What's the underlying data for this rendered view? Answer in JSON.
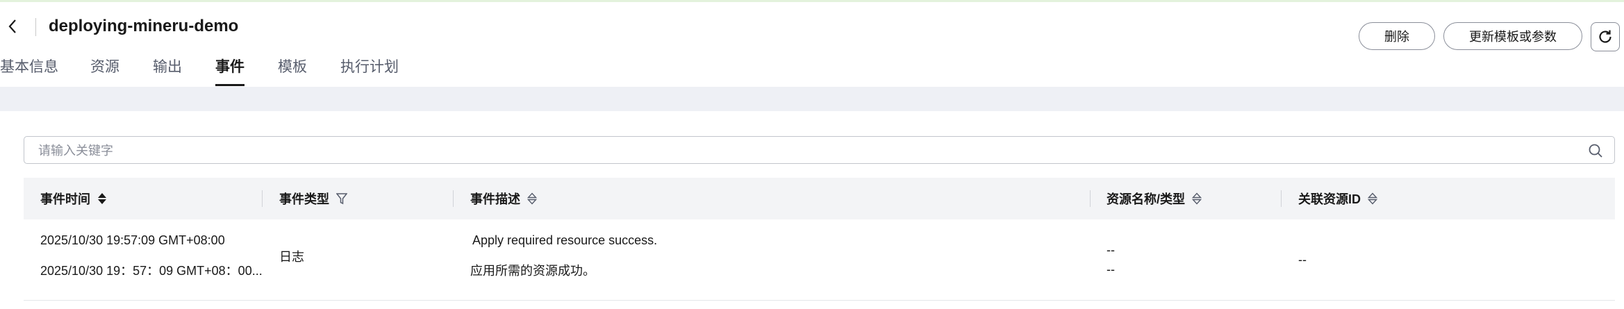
{
  "header": {
    "title": "deploying-mineru-demo",
    "delete_label": "删除",
    "update_label": "更新模板或参数"
  },
  "tabs": [
    {
      "label": "基本信息",
      "active": false
    },
    {
      "label": "资源",
      "active": false
    },
    {
      "label": "输出",
      "active": false
    },
    {
      "label": "事件",
      "active": true
    },
    {
      "label": "模板",
      "active": false
    },
    {
      "label": "执行计划",
      "active": false
    }
  ],
  "search": {
    "placeholder": "请输入关键字",
    "value": ""
  },
  "table": {
    "columns": [
      "事件时间",
      "事件类型",
      "事件描述",
      "资源名称/类型",
      "关联资源ID"
    ],
    "rows": [
      {
        "time_line1": "2025/10/30 19:57:09 GMT+08:00",
        "time_line2": "2025/10/30 19：57：09 GMT+08：00...",
        "type": "日志",
        "desc_line1": "Apply required resource success.",
        "desc_line2": "应用所需的资源成功。",
        "resource_line1": "--",
        "resource_line2": "--",
        "resource_id": "--"
      }
    ]
  },
  "icons": {
    "back": "chevron-left-icon",
    "refresh": "refresh-icon",
    "search": "search-icon",
    "sort": "sort-icon",
    "filter": "filter-icon"
  },
  "colors": {
    "accent_bar": "#e3f2dc",
    "band": "#eef0f5",
    "table_head": "#f3f4f6",
    "border": "#8a8e99"
  }
}
